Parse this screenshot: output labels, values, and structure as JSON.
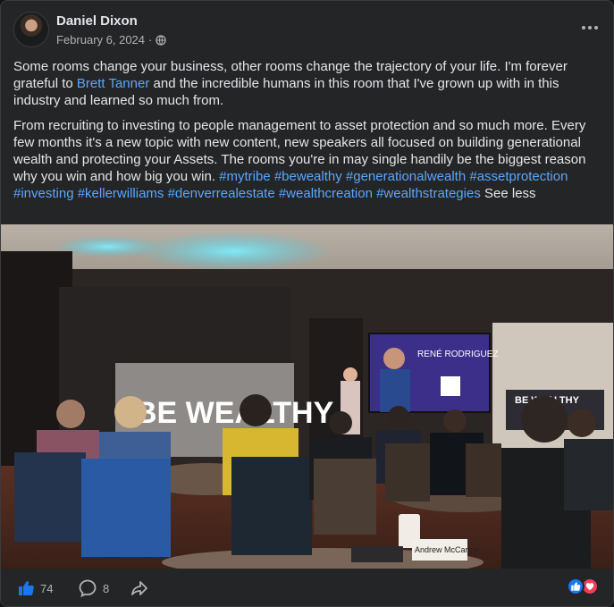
{
  "post": {
    "author": "Daniel Dixon",
    "date": "February 6, 2024",
    "separator": "·",
    "privacy_icon": "globe-icon",
    "menu_icon": "more-icon"
  },
  "body": {
    "p1_a": "Some rooms change your business, other rooms change the trajectory of your life. I'm forever grateful to ",
    "p1_link": "Brett Tanner",
    "p1_b": " and the incredible humans in this room that I've grown up with in this industry and learned so much from.",
    "p2": "From recruiting to investing to people management to asset protection and so much more. Every few months it's a new topic with new content, new speakers all focused on building generational wealth and protecting your Assets. The rooms you're in may single handily be the biggest reason why you win and how big you win. ",
    "hashtags": [
      "#mytribe",
      "#bewealthy",
      "#generationalwealth",
      "#assetprotection",
      "#investing",
      "#kellerwilliams",
      "#denverrealestate",
      "#wealthcreation",
      "#wealthstrategies"
    ],
    "see_less": "See less"
  },
  "photo": {
    "stage_sign": "BE WEALTHY",
    "screen_name": "RENÉ RODRIGUEZ",
    "side_sign": "BE WEALTHY",
    "table_tent": "Andrew McCarger"
  },
  "footer": {
    "like_count": "74",
    "comment_count": "8",
    "like_icon": "thumbs-up-icon",
    "comment_icon": "comment-icon",
    "share_icon": "share-icon",
    "colors": {
      "like_blue": "#1877f2",
      "love_red": "#f33e58",
      "link_blue": "#5aa7ff"
    }
  }
}
